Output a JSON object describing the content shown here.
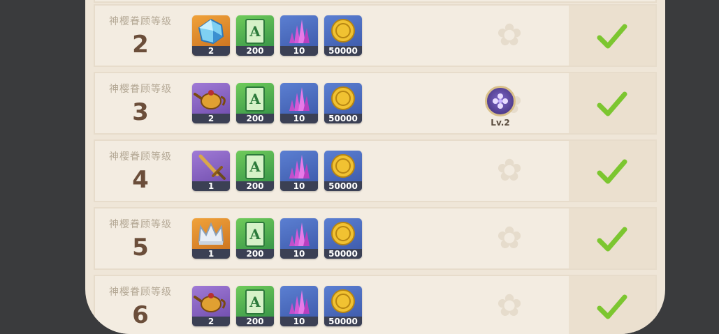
{
  "rows": [
    {
      "label": "神樱眷顾等级",
      "level": "2",
      "items": [
        {
          "icon": "crystal-chunk-icon",
          "bg": "orange",
          "count": "2"
        },
        {
          "icon": "skill-book-icon",
          "bg": "green",
          "count": "200"
        },
        {
          "icon": "purple-crystal-icon",
          "bg": "blue",
          "count": "10"
        },
        {
          "icon": "mora-coin-icon",
          "bg": "blue",
          "count": "50000"
        }
      ],
      "completed": true
    },
    {
      "label": "神樱眷顾等级",
      "level": "3",
      "items": [
        {
          "icon": "teapot-icon",
          "bg": "purple",
          "count": "2"
        },
        {
          "icon": "skill-book-icon",
          "bg": "green",
          "count": "200"
        },
        {
          "icon": "purple-crystal-icon",
          "bg": "blue",
          "count": "10"
        },
        {
          "icon": "mora-coin-icon",
          "bg": "blue",
          "count": "50000"
        }
      ],
      "unlock": {
        "icon": "electro-flower-icon",
        "level": "Lv.2"
      },
      "completed": true
    },
    {
      "label": "神樱眷顾等级",
      "level": "4",
      "items": [
        {
          "icon": "sword-icon",
          "bg": "purple",
          "count": "1"
        },
        {
          "icon": "skill-book-icon",
          "bg": "green",
          "count": "200"
        },
        {
          "icon": "purple-crystal-icon",
          "bg": "blue",
          "count": "10"
        },
        {
          "icon": "mora-coin-icon",
          "bg": "blue",
          "count": "50000"
        }
      ],
      "completed": true
    },
    {
      "label": "神樱眷顾等级",
      "level": "5",
      "items": [
        {
          "icon": "crown-icon",
          "bg": "orange",
          "count": "1"
        },
        {
          "icon": "skill-book-icon",
          "bg": "green",
          "count": "200"
        },
        {
          "icon": "purple-crystal-icon",
          "bg": "blue",
          "count": "10"
        },
        {
          "icon": "mora-coin-icon",
          "bg": "blue",
          "count": "50000"
        }
      ],
      "completed": true
    },
    {
      "label": "神樱眷顾等级",
      "level": "6",
      "items": [
        {
          "icon": "teapot-icon",
          "bg": "purple",
          "count": "2"
        },
        {
          "icon": "skill-book-icon",
          "bg": "green",
          "count": "200"
        },
        {
          "icon": "purple-crystal-icon",
          "bg": "blue",
          "count": "10"
        },
        {
          "icon": "mora-coin-icon",
          "bg": "blue",
          "count": "50000"
        }
      ],
      "completed": true
    }
  ],
  "colors": {
    "check": "#7cc630",
    "level_text": "#6b4e3a",
    "label_text": "#b4a895"
  }
}
